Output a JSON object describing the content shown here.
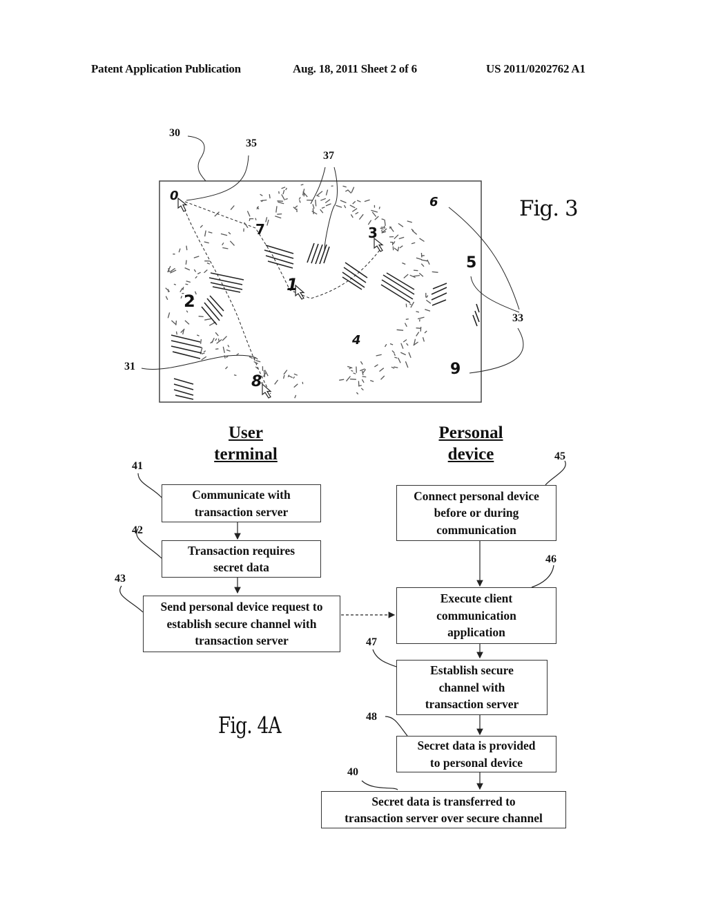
{
  "header": {
    "left": "Patent Application Publication",
    "middle": "Aug. 18, 2011  Sheet 2 of 6",
    "right": "US 2011/0202762 A1"
  },
  "fig3": {
    "label": "Fig. 3",
    "refs": {
      "r30": "30",
      "r35": "35",
      "r37": "37",
      "r33": "33",
      "r31": "31"
    },
    "digits": {
      "d0": "0",
      "d1": "1",
      "d2": "2",
      "d3": "3",
      "d4": "4",
      "d5": "5",
      "d6": "6",
      "d7": "7",
      "d8": "8",
      "d9": "9"
    }
  },
  "fig4a": {
    "label": "Fig. 4A",
    "columns": {
      "user_terminal": "User\nterminal",
      "personal_device": "Personal\ndevice"
    },
    "steps": {
      "s41": {
        "ref": "41",
        "text": "Communicate with\ntransaction server"
      },
      "s42": {
        "ref": "42",
        "text": "Transaction requires\nsecret data"
      },
      "s43": {
        "ref": "43",
        "text": "Send personal device request to\nestablish secure channel with\ntransaction server"
      },
      "s45": {
        "ref": "45",
        "text": "Connect personal device\nbefore or during\ncommunication"
      },
      "s46": {
        "ref": "46",
        "text": "Execute client\ncommunication\napplication"
      },
      "s47": {
        "ref": "47",
        "text": "Establish secure\nchannel with\ntransaction server"
      },
      "s48": {
        "ref": "48",
        "text": "Secret data is provided\nto personal device"
      },
      "s40": {
        "ref": "40",
        "text": "Secret data is transferred to\ntransaction server over secure channel"
      }
    }
  }
}
